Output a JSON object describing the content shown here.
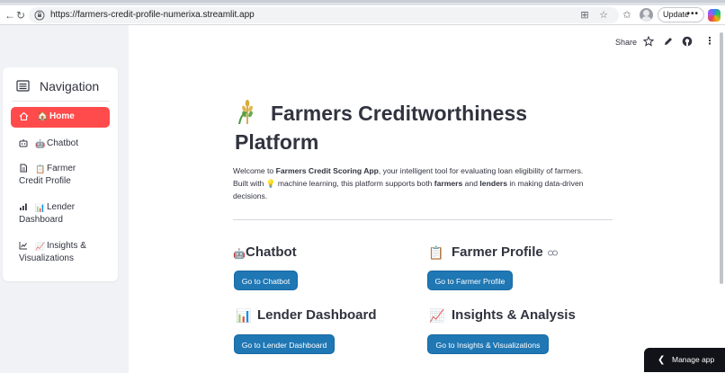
{
  "browser": {
    "url": "https://farmers-credit-profile-numerixa.streamlit.app",
    "update_label": "Update",
    "more_label": "•••"
  },
  "toolbar": {
    "share_label": "Share"
  },
  "sidebar": {
    "title": "Navigation",
    "items": [
      {
        "emoji": "🏠",
        "label": "Home",
        "active": true
      },
      {
        "emoji": "🤖",
        "label": "Chatbot",
        "active": false
      },
      {
        "emoji": "📋",
        "label": "Farmer",
        "label2": "Credit Profile",
        "active": false
      },
      {
        "emoji": "📊",
        "label": "Lender",
        "label2": "Dashboard",
        "active": false
      },
      {
        "emoji": "📈",
        "label": "Insights &",
        "label2": "Visualizations",
        "active": false
      }
    ]
  },
  "main": {
    "title_line1": "Farmers Creditworthiness",
    "title_line2": "Platform",
    "intro": {
      "p1": "Welcome to ",
      "app_name": "Farmers Credit Scoring App",
      "p2": ", your intelligent tool for evaluating loan eligibility of farmers.",
      "p3": "Built with ",
      "bulb": "💡",
      "p4": " machine learning, this platform supports both ",
      "farmers": "farmers",
      "p5": " and ",
      "lenders": "lenders",
      "p6": " in making data-driven",
      "p7": "decisions."
    },
    "cards": [
      {
        "emoji": "🤖",
        "heading": "Chatbot",
        "button": "Go to Chatbot"
      },
      {
        "emoji": "📋",
        "heading": "Farmer Profile",
        "button": "Go to Farmer Profile"
      },
      {
        "emoji": "📊",
        "heading": "Lender Dashboard",
        "button": "Go to Lender Dashboard"
      },
      {
        "emoji": "📈",
        "heading": "Insights & Analysis",
        "button": "Go to Insights & Visualizations"
      }
    ]
  },
  "manage_app": {
    "label": "Manage app"
  },
  "colors": {
    "active_nav": "#ff4b4b",
    "button": "#1f77b4",
    "manage_bg": "#111318"
  }
}
